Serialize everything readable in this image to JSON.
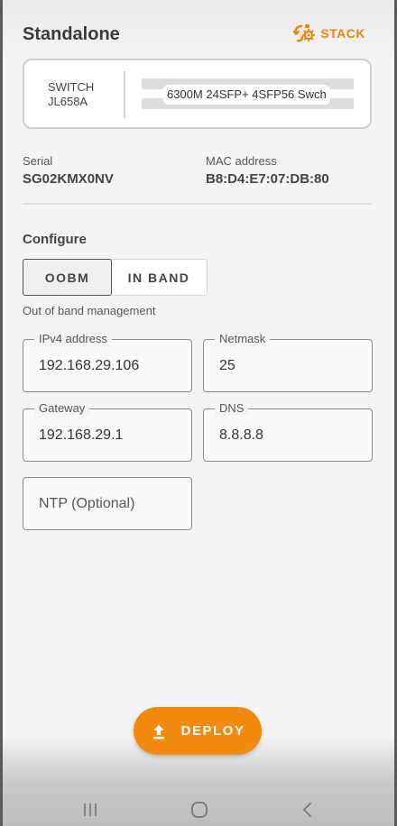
{
  "header": {
    "title": "Standalone",
    "stack_label": "STACK",
    "accent_color": "#f28a10"
  },
  "switch_card": {
    "type": "SWITCH",
    "part_number": "JL658A",
    "model": "6300M 24SFP+ 4SFP56 Swch"
  },
  "info": {
    "serial_label": "Serial",
    "serial_value": "SG02KMX0NV",
    "mac_label": "MAC address",
    "mac_value": "B8:D4:E7:07:DB:80"
  },
  "configure": {
    "title": "Configure",
    "options": [
      "OOBM",
      "IN BAND"
    ],
    "selected": "OOBM",
    "description": "Out of band management"
  },
  "fields": {
    "ipv4": {
      "label": "IPv4 address",
      "value": "192.168.29.106"
    },
    "netmask": {
      "label": "Netmask",
      "value": "25"
    },
    "gateway": {
      "label": "Gateway",
      "value": "192.168.29.1"
    },
    "dns": {
      "label": "DNS",
      "value": "8.8.8.8"
    },
    "ntp": {
      "placeholder": "NTP (Optional)",
      "value": ""
    }
  },
  "deploy": {
    "label": "DEPLOY",
    "icon": "upload-icon"
  },
  "navbar": {
    "icons": [
      "recent-apps-icon",
      "home-icon",
      "back-icon"
    ]
  }
}
